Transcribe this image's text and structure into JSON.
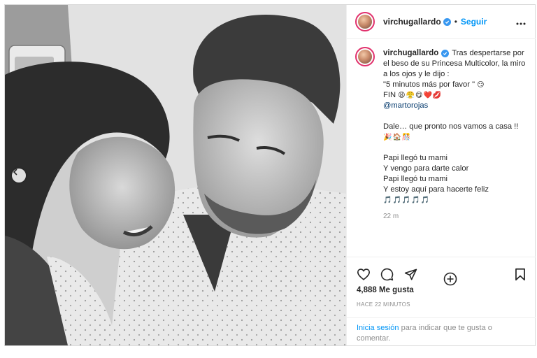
{
  "post": {
    "username": "virchugallardo",
    "follow_label": "Seguir",
    "separator": "•",
    "caption": {
      "line1": "Tras despertarse por el beso de su Princesa Multicolor, la miro a los ojos y le dijo :",
      "line2": "\"5 minutos más por favor \"",
      "line2_emoji": "😏",
      "fin": "FIN",
      "fin_emojis": "😩😤😋❤️💋",
      "mention": "@martorojas",
      "dale": "Dale… que pronto nos vamos a casa !!",
      "dale_emojis": "🎉🏠🎊",
      "song1": "Papi llegó tu mami",
      "song2": "Y vengo para darte calor",
      "song3": "Papi llegó tu mami",
      "song4": "Y estoy aquí para hacerte feliz",
      "song_emojis": "🎵🎵🎵🎵🎵",
      "time": "22 m"
    },
    "likes": "4,888 Me gusta",
    "posted_ago": "HACE 22 MINUTOS",
    "login_link": "Inicia sesión",
    "login_text": " para indicar que te gusta o comentar."
  },
  "icons": {
    "more": "more-options-icon",
    "verified": "verified-badge-icon",
    "like": "heart-icon",
    "comment": "comment-icon",
    "share": "paper-plane-icon",
    "save": "bookmark-icon",
    "add": "add-circle-icon",
    "prev": "chevron-left-icon"
  },
  "colors": {
    "accent_blue": "#0095f6",
    "verified_blue": "#3897f0",
    "muted_text": "#8e8e8e",
    "text": "#262626",
    "border": "#dbdbdb"
  }
}
